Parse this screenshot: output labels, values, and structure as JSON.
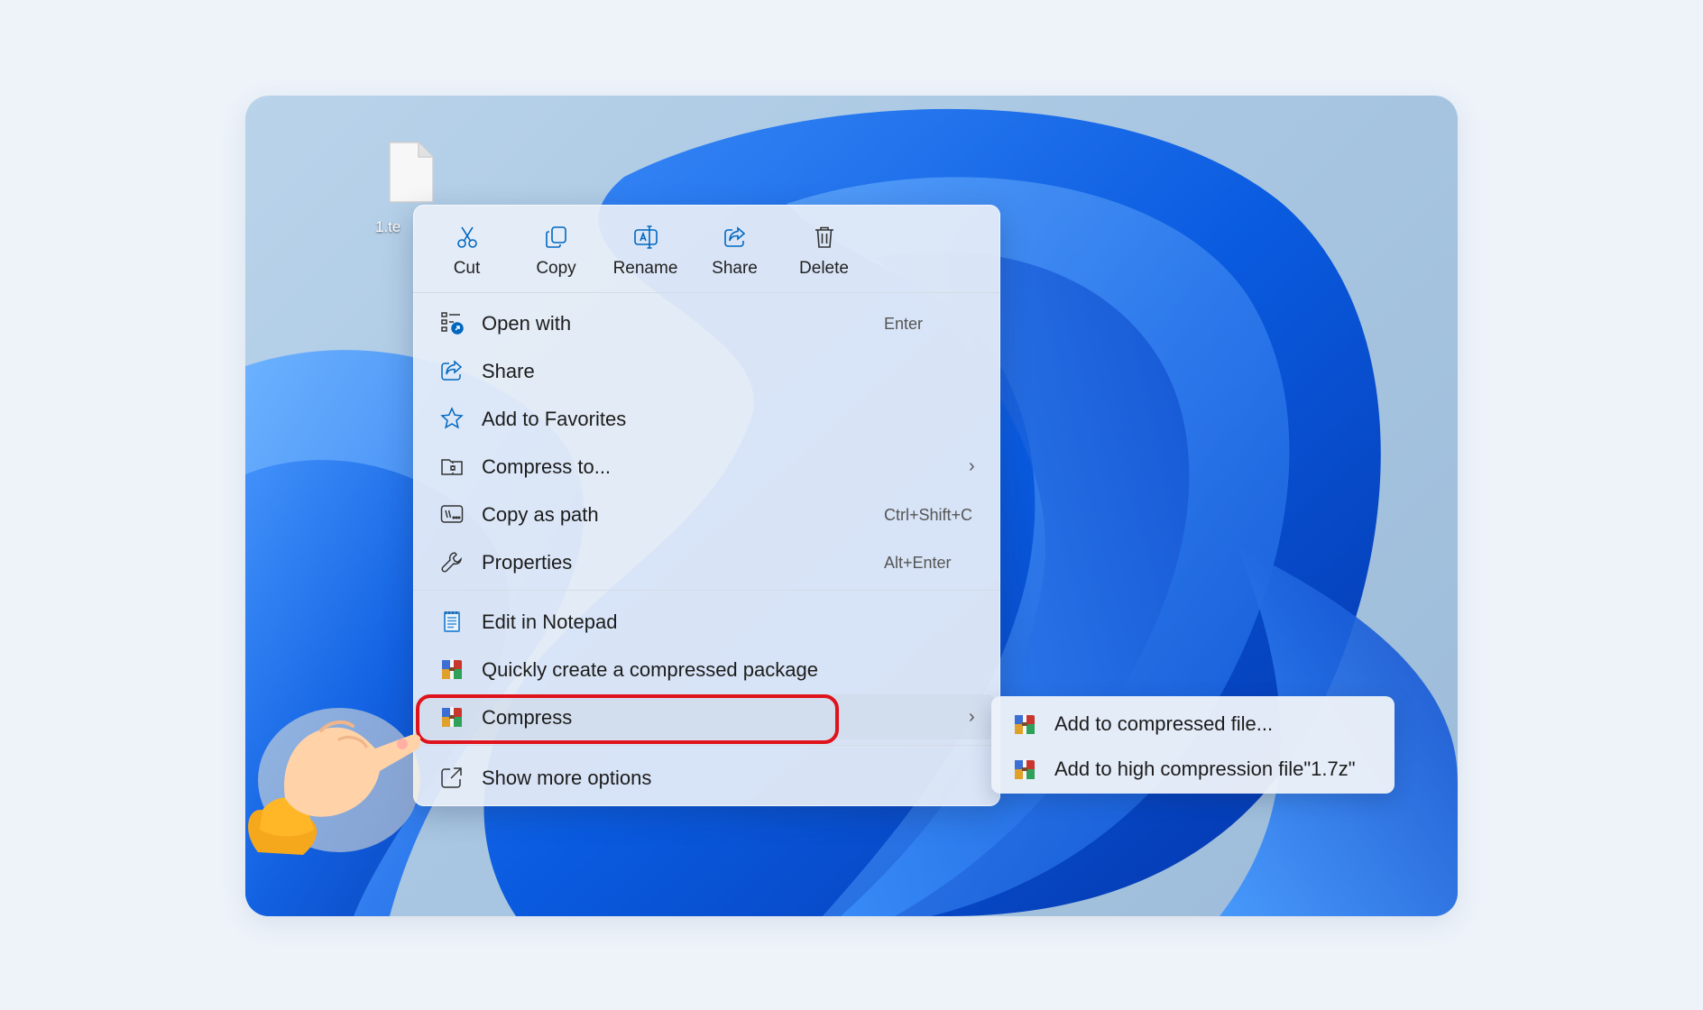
{
  "desktop": {
    "file_label": "1.te"
  },
  "quick_actions": [
    {
      "label": "Cut",
      "icon": "scissors-icon"
    },
    {
      "label": "Copy",
      "icon": "copy-icon"
    },
    {
      "label": "Rename",
      "icon": "rename-icon"
    },
    {
      "label": "Share",
      "icon": "share-icon"
    },
    {
      "label": "Delete",
      "icon": "trash-icon"
    }
  ],
  "menu_items": [
    {
      "label": "Open with",
      "shortcut": "Enter",
      "icon": "open-with-icon"
    },
    {
      "label": "Share",
      "shortcut": "",
      "icon": "share-icon"
    },
    {
      "label": "Add to Favorites",
      "shortcut": "",
      "icon": "star-icon"
    },
    {
      "label": "Compress to...",
      "shortcut": "",
      "icon": "zip-folder-icon",
      "submenu": true
    },
    {
      "label": "Copy as path",
      "shortcut": "Ctrl+Shift+C",
      "icon": "copy-path-icon"
    },
    {
      "label": "Properties",
      "shortcut": "Alt+Enter",
      "icon": "wrench-icon"
    }
  ],
  "app_items": [
    {
      "label": "Edit in Notepad",
      "icon": "notepad-icon"
    },
    {
      "label": "Quickly create a compressed package",
      "icon": "archive-app-icon"
    },
    {
      "label": "Compress",
      "icon": "archive-app-icon",
      "submenu": true
    }
  ],
  "more_options": {
    "label": "Show more options",
    "icon": "external-options-icon"
  },
  "submenu_items": [
    {
      "label": "Add to compressed file...",
      "icon": "archive-app-icon"
    },
    {
      "label": "Add to high compression file\"1.7z\"",
      "icon": "archive-app-icon"
    }
  ],
  "colors": {
    "accent": "#0067c0",
    "highlight_border": "#e0121b",
    "wallpaper_blue": "#0a5fe0"
  }
}
